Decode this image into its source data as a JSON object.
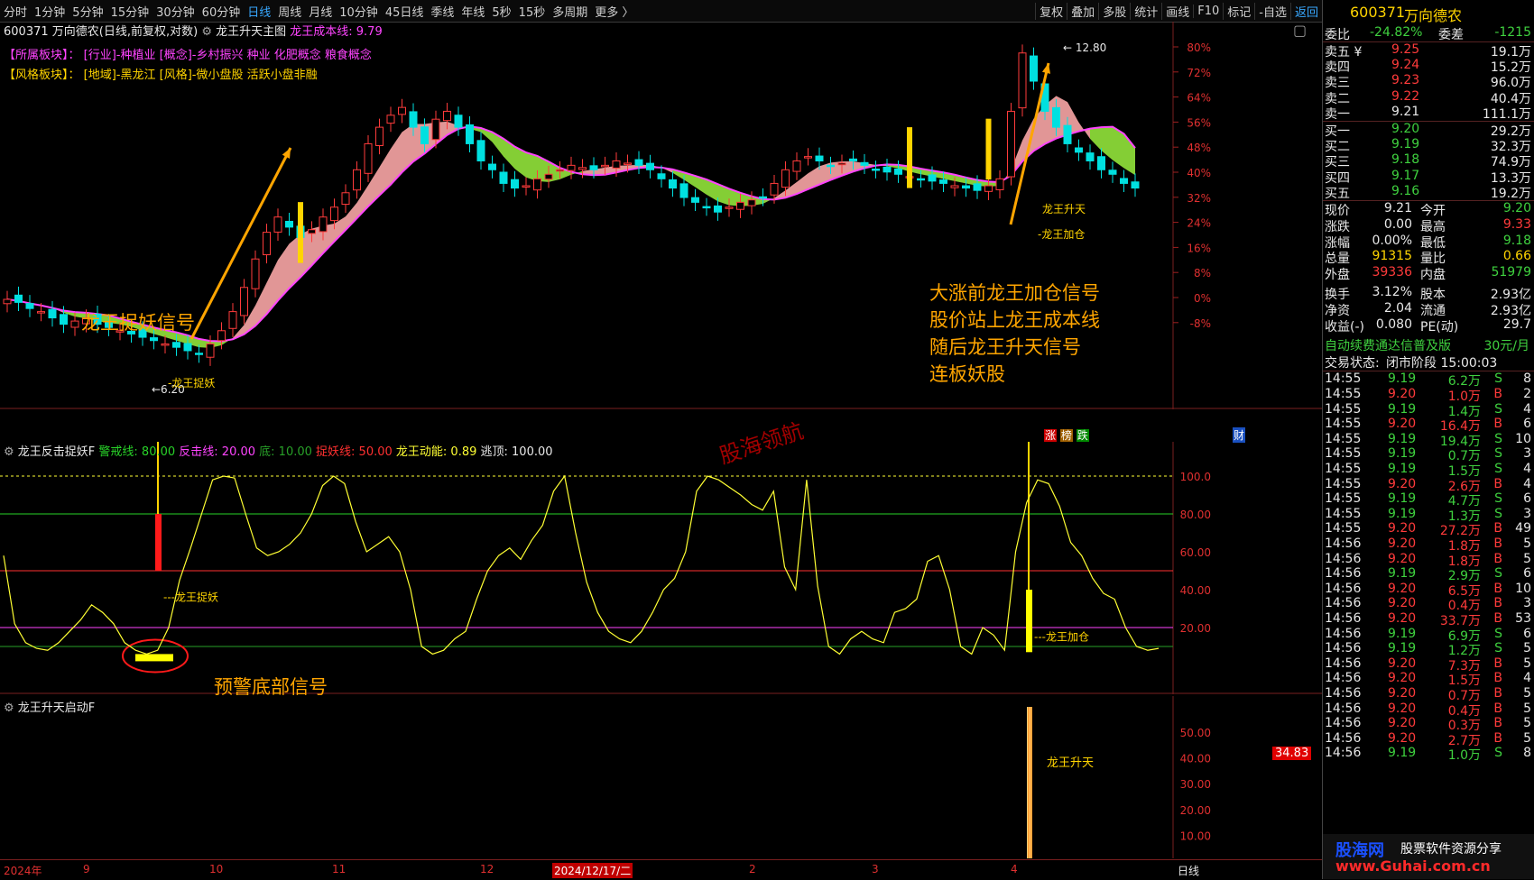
{
  "toolbar": {
    "items": [
      "分时",
      "1分钟",
      "5分钟",
      "15分钟",
      "30分钟",
      "60分钟",
      "日线",
      "周线",
      "月线",
      "10分钟",
      "45日线",
      "季线",
      "年线",
      "5秒",
      "15秒",
      "多周期",
      "更多 〉"
    ],
    "active_index": 6,
    "right_items": [
      "复权",
      "叠加",
      "多股",
      "统计",
      "画线",
      "F10",
      "标记",
      "-自选"
    ],
    "back_label": "返回"
  },
  "main_chart": {
    "title": "600371 万向德农(日线,前复权,对数)",
    "indicator_name": "龙王升天主图",
    "cost_line_label": "龙王成本线: 9.79",
    "sector_label": "【所属板块】：",
    "sector_text": "[行业]-种植业 [概念]-乡村振兴 种业 化肥概念 粮食概念",
    "style_label": "【风格板块】：",
    "style_text": "[地域]-黑龙江 [风格]-微小盘股 活跃小盘非融",
    "axis_labels": [
      "80%",
      "72%",
      "64%",
      "56%",
      "48%",
      "40%",
      "32%",
      "24%",
      "16%",
      "8%",
      "0%",
      "-8%"
    ],
    "high_label": "12.80",
    "low_label": "6.20",
    "signal_catch": "龙王捉妖",
    "signal_rise": "龙王升天",
    "signal_add": "龙王加仓",
    "note_catch": "龙王捉妖信号",
    "note_lines": [
      "大涨前龙王加仓信号",
      "股价站上龙王成本线",
      "随后龙王升天信号",
      "连板妖股"
    ],
    "badge_zhang": "涨",
    "badge_bang": "榜",
    "badge_die": "跌",
    "badge_cai": "财",
    "watermark": "股海领航"
  },
  "osc": {
    "name": "龙王反击捉妖F",
    "legend": [
      {
        "label": "警戒线: 80.00",
        "color": "#28d228"
      },
      {
        "label": "反击线: 20.00",
        "color": "#ff44ff"
      },
      {
        "label": "底: 10.00",
        "color": "#28a028"
      },
      {
        "label": "捉妖线: 50.00",
        "color": "#ff3030"
      },
      {
        "label": "龙王动能: 0.89",
        "color": "#ffff33"
      },
      {
        "label": "逃顶: 100.00",
        "color": "#e8e8e8"
      }
    ],
    "axis_labels": [
      "100.0",
      "80.00",
      "60.00",
      "40.00",
      "20.00"
    ],
    "bar_catch_label": "---龙王捉妖",
    "bar_add_label": "---龙王加仓",
    "note_bottom": "预警底部信号",
    "series": [
      58,
      22,
      12,
      9,
      8,
      12,
      18,
      24,
      32,
      28,
      22,
      12,
      8,
      6,
      8,
      20,
      45,
      62,
      80,
      98,
      100,
      99,
      80,
      62,
      58,
      60,
      64,
      70,
      80,
      95,
      100,
      96,
      76,
      60,
      64,
      68,
      60,
      40,
      10,
      6,
      8,
      14,
      18,
      35,
      50,
      58,
      62,
      56,
      66,
      74,
      92,
      100,
      70,
      44,
      28,
      18,
      14,
      12,
      18,
      28,
      40,
      46,
      60,
      92,
      100,
      98,
      94,
      90,
      85,
      82,
      92,
      52,
      40,
      98,
      42,
      10,
      6,
      14,
      18,
      14,
      12,
      28,
      30,
      35,
      55,
      58,
      40,
      10,
      6,
      20,
      16,
      8,
      60,
      86,
      98,
      96,
      84,
      65,
      58,
      46,
      38,
      35,
      20,
      10,
      8,
      9
    ]
  },
  "startup": {
    "name": "龙王升天启动F",
    "axis_labels": [
      "50.00",
      "40.00",
      "30.00",
      "20.00",
      "10.00"
    ],
    "current_value": "34.83",
    "rise_label": "龙王升天"
  },
  "date_axis": {
    "labels": [
      "2024年",
      "9",
      "10",
      "11",
      "12",
      "2024/12/17/二",
      "2",
      "3",
      "4"
    ],
    "period": "日线"
  },
  "quote": {
    "code": "600371",
    "name": "万向德农",
    "weibi_label": "委比",
    "weibi": "-24.82%",
    "weicha_label": "委差",
    "weicha": "-1215",
    "sell": [
      {
        "label": "卖五",
        "mark": "¥",
        "price": "9.25",
        "vol": "19.1万"
      },
      {
        "label": "卖四",
        "mark": "",
        "price": "9.24",
        "vol": "15.2万"
      },
      {
        "label": "卖三",
        "mark": "",
        "price": "9.23",
        "vol": "96.0万"
      },
      {
        "label": "卖二",
        "mark": "",
        "price": "9.22",
        "vol": "40.4万"
      },
      {
        "label": "卖一",
        "mark": "",
        "price": "9.21",
        "vol": "111.1万"
      }
    ],
    "buy": [
      {
        "label": "买一",
        "price": "9.20",
        "vol": "29.2万"
      },
      {
        "label": "买二",
        "price": "9.19",
        "vol": "32.3万"
      },
      {
        "label": "买三",
        "price": "9.18",
        "vol": "74.9万"
      },
      {
        "label": "买四",
        "price": "9.17",
        "vol": "13.3万"
      },
      {
        "label": "买五",
        "price": "9.16",
        "vol": "19.2万"
      }
    ],
    "stats": [
      {
        "l1": "现价",
        "v1": "9.21",
        "c1": "wht",
        "l2": "今开",
        "v2": "9.20",
        "c2": "grn"
      },
      {
        "l1": "涨跌",
        "v1": "0.00",
        "c1": "wht",
        "l2": "最高",
        "v2": "9.33",
        "c2": "red"
      },
      {
        "l1": "涨幅",
        "v1": "0.00%",
        "c1": "wht",
        "l2": "最低",
        "v2": "9.18",
        "c2": "grn"
      },
      {
        "l1": "总量",
        "v1": "91315",
        "c1": "yel",
        "l2": "量比",
        "v2": "0.66",
        "c2": "yel"
      },
      {
        "l1": "外盘",
        "v1": "39336",
        "c1": "red",
        "l2": "内盘",
        "v2": "51979",
        "c2": "grn"
      },
      {
        "l1": "换手",
        "v1": "3.12%",
        "c1": "wht",
        "l2": "股本",
        "v2": "2.93亿",
        "c2": "wht"
      },
      {
        "l1": "净资",
        "v1": "2.04",
        "c1": "wht",
        "l2": "流通",
        "v2": "2.93亿",
        "c2": "wht"
      },
      {
        "l1": "收益(-)",
        "v1": "0.080",
        "c1": "wht",
        "l2": "PE(动)",
        "v2": "29.7",
        "c2": "wht"
      }
    ],
    "promo": "自动续费通达信普及版",
    "promo_price": "30元/月",
    "status_label": "交易状态:",
    "status": "闭市阶段 15:00:03",
    "ticks": [
      {
        "t": "14:55",
        "p": "9.19",
        "v": "6.2万",
        "s": "S",
        "n": "8"
      },
      {
        "t": "14:55",
        "p": "9.20",
        "v": "1.0万",
        "s": "B",
        "n": "2"
      },
      {
        "t": "14:55",
        "p": "9.19",
        "v": "1.4万",
        "s": "S",
        "n": "4"
      },
      {
        "t": "14:55",
        "p": "9.20",
        "v": "16.4万",
        "s": "B",
        "n": "6"
      },
      {
        "t": "14:55",
        "p": "9.19",
        "v": "19.4万",
        "s": "S",
        "n": "10"
      },
      {
        "t": "14:55",
        "p": "9.19",
        "v": "0.7万",
        "s": "S",
        "n": "3"
      },
      {
        "t": "14:55",
        "p": "9.19",
        "v": "1.5万",
        "s": "S",
        "n": "4"
      },
      {
        "t": "14:55",
        "p": "9.20",
        "v": "2.6万",
        "s": "B",
        "n": "4"
      },
      {
        "t": "14:55",
        "p": "9.19",
        "v": "4.7万",
        "s": "S",
        "n": "6"
      },
      {
        "t": "14:55",
        "p": "9.19",
        "v": "1.3万",
        "s": "S",
        "n": "3"
      },
      {
        "t": "14:55",
        "p": "9.20",
        "v": "27.2万",
        "s": "B",
        "n": "49"
      },
      {
        "t": "14:56",
        "p": "9.20",
        "v": "1.8万",
        "s": "B",
        "n": "5"
      },
      {
        "t": "14:56",
        "p": "9.20",
        "v": "1.8万",
        "s": "B",
        "n": "5"
      },
      {
        "t": "14:56",
        "p": "9.19",
        "v": "2.9万",
        "s": "S",
        "n": "6"
      },
      {
        "t": "14:56",
        "p": "9.20",
        "v": "6.5万",
        "s": "B",
        "n": "10"
      },
      {
        "t": "14:56",
        "p": "9.20",
        "v": "0.4万",
        "s": "B",
        "n": "3"
      },
      {
        "t": "14:56",
        "p": "9.20",
        "v": "33.7万",
        "s": "B",
        "n": "53"
      },
      {
        "t": "14:56",
        "p": "9.19",
        "v": "6.9万",
        "s": "S",
        "n": "6"
      },
      {
        "t": "14:56",
        "p": "9.19",
        "v": "1.2万",
        "s": "S",
        "n": "5"
      },
      {
        "t": "14:56",
        "p": "9.20",
        "v": "7.3万",
        "s": "B",
        "n": "5"
      },
      {
        "t": "14:56",
        "p": "9.20",
        "v": "1.5万",
        "s": "B",
        "n": "4"
      },
      {
        "t": "14:56",
        "p": "9.20",
        "v": "0.7万",
        "s": "B",
        "n": "5"
      },
      {
        "t": "14:56",
        "p": "9.20",
        "v": "0.4万",
        "s": "B",
        "n": "5"
      },
      {
        "t": "14:56",
        "p": "9.20",
        "v": "0.3万",
        "s": "B",
        "n": "5"
      },
      {
        "t": "14:56",
        "p": "9.20",
        "v": "2.7万",
        "s": "B",
        "n": "5"
      },
      {
        "t": "14:56",
        "p": "9.19",
        "v": "1.0万",
        "s": "S",
        "n": "8"
      }
    ]
  },
  "watermark_site": "股海网",
  "watermark_desc": "股票软件资源分享",
  "watermark_url": "www.Guhai.com.cn",
  "colors": {
    "up": "#ff3b3b",
    "down": "#00e0e0",
    "ma": "#ff44ff",
    "cloud_up": "#f4a3a3",
    "cloud_down": "#8fe03a",
    "accent": "#ffa500"
  }
}
